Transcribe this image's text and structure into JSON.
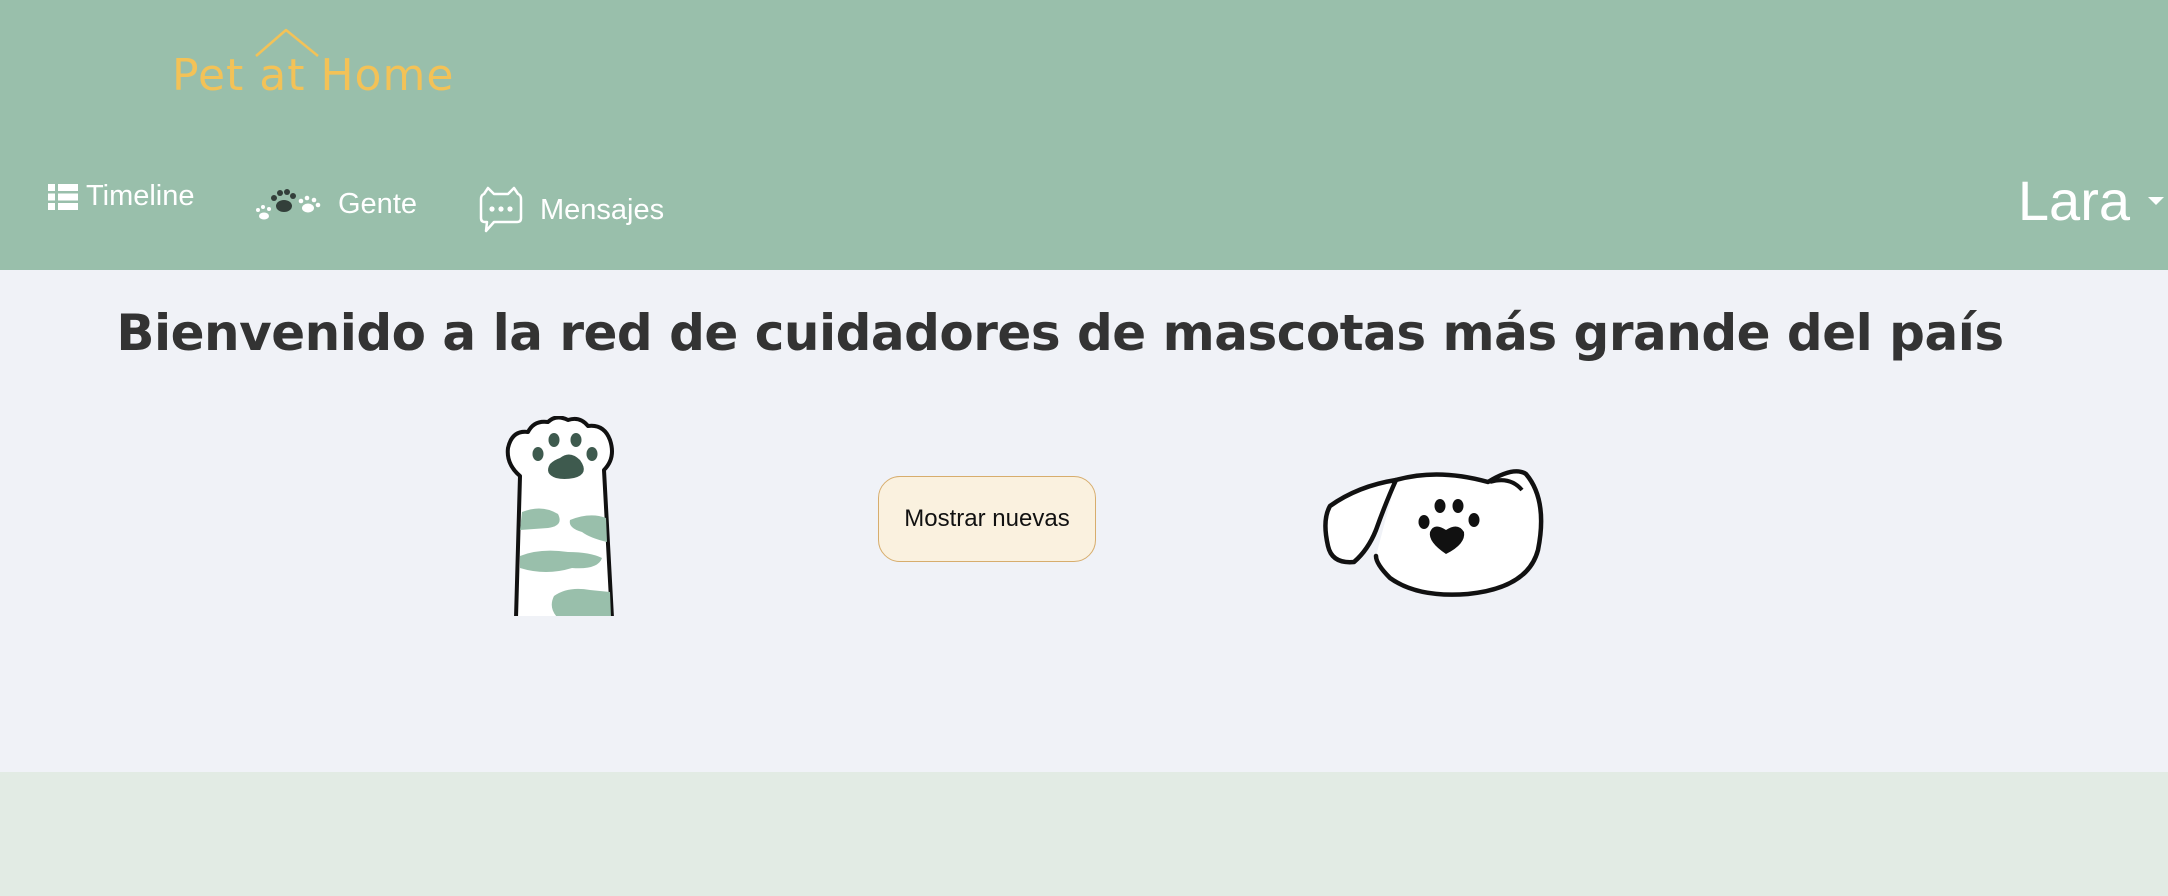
{
  "header": {
    "logo_text": "Pet at Home",
    "nav": {
      "timeline": "Timeline",
      "gente": "Gente",
      "mensajes": "Mensajes"
    },
    "user": "Lara"
  },
  "main": {
    "headline": "Bienvenido a la red de cuidadores de mascotas más grande del país",
    "show_new_label": "Mostrar nuevas"
  },
  "icons": {
    "timeline": "list-icon",
    "gente": "paws-icon",
    "mensajes": "chat-bubble-icon",
    "user_caret": "caret-down-icon"
  },
  "colors": {
    "header_bg": "#99bfab",
    "logo": "#f3c257",
    "content_bg": "#f0f2f7",
    "footer_bg": "#e2ebe4",
    "button_bg": "#faf1df",
    "button_border": "#d7ad6d"
  }
}
